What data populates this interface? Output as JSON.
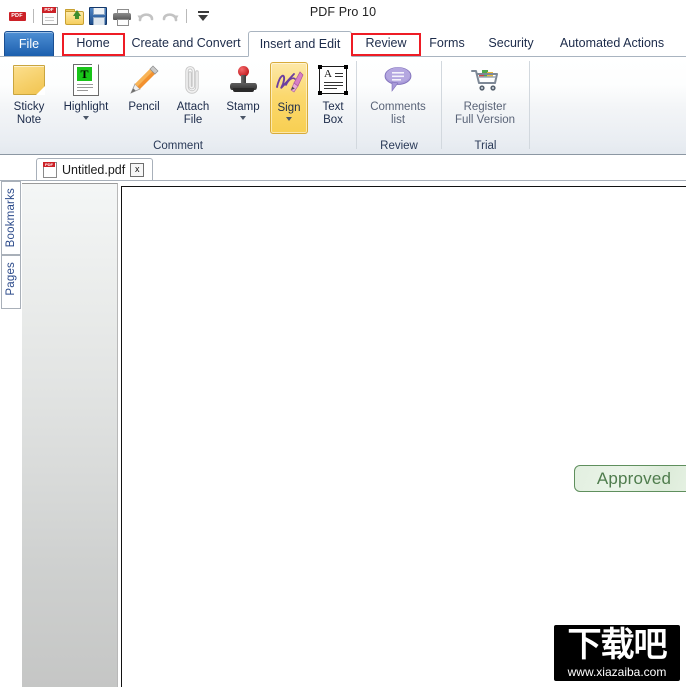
{
  "window": {
    "title": "PDF Pro 10"
  },
  "quick_access": {
    "items": [
      {
        "name": "app-pdf-icon",
        "label": "PDF"
      },
      {
        "name": "new-pdf-icon",
        "label": "PDF"
      },
      {
        "name": "open-file-icon",
        "label": ""
      },
      {
        "name": "save-icon",
        "label": ""
      },
      {
        "name": "print-icon",
        "label": ""
      },
      {
        "name": "undo-icon",
        "label": ""
      },
      {
        "name": "redo-icon",
        "label": ""
      },
      {
        "name": "customize-toolbar-icon",
        "label": ""
      }
    ]
  },
  "ribbon_tabs": {
    "file": "File",
    "items": [
      {
        "label": "Home",
        "highlighted": true,
        "active": false
      },
      {
        "label": "Create and Convert",
        "highlighted": false,
        "active": false
      },
      {
        "label": "Insert and Edit",
        "highlighted": false,
        "active": false
      },
      {
        "label": "Review",
        "highlighted": true,
        "active": true
      },
      {
        "label": "Forms",
        "highlighted": false,
        "active": false
      },
      {
        "label": "Security",
        "highlighted": false,
        "active": false
      },
      {
        "label": "Automated Actions",
        "highlighted": false,
        "active": false
      }
    ]
  },
  "ribbon": {
    "groups": [
      {
        "label": "Comment"
      },
      {
        "label": "Review"
      },
      {
        "label": "Trial"
      }
    ],
    "buttons": [
      {
        "line1": "Sticky",
        "line2": "Note",
        "icon": "sticky-note-icon",
        "dropdown": false,
        "selected": false
      },
      {
        "line1": "Highlight",
        "line2": "",
        "icon": "highlight-text-icon",
        "dropdown": true,
        "selected": false
      },
      {
        "line1": "Pencil",
        "line2": "",
        "icon": "pencil-icon",
        "dropdown": false,
        "selected": false
      },
      {
        "line1": "Attach",
        "line2": "File",
        "icon": "paperclip-icon",
        "dropdown": false,
        "selected": false
      },
      {
        "line1": "Stamp",
        "line2": "",
        "icon": "stamp-icon",
        "dropdown": true,
        "selected": false
      },
      {
        "line1": "Sign",
        "line2": "",
        "icon": "signature-icon",
        "dropdown": true,
        "selected": true
      },
      {
        "line1": "Text",
        "line2": "Box",
        "icon": "text-box-icon",
        "dropdown": false,
        "selected": false
      },
      {
        "line1": "Comments",
        "line2": "list",
        "icon": "comment-bubble-icon",
        "dropdown": false,
        "selected": false
      },
      {
        "line1": "Register",
        "line2": "Full Version",
        "icon": "shopping-cart-icon",
        "dropdown": false,
        "selected": false
      }
    ]
  },
  "document_tab": {
    "filename": "Untitled.pdf",
    "close_label": "x",
    "icon": "pdf-file-icon"
  },
  "side_tabs": [
    {
      "label": "Bookmarks"
    },
    {
      "label": "Pages"
    }
  ],
  "page_content": {
    "stamp": {
      "text": "Approved",
      "border_color": "#5f8f5d",
      "text_color": "#4f7c4d",
      "fill_color": "#e5f1e2"
    }
  },
  "watermark": {
    "brand": "下载吧",
    "url": "www.xiazaiba.com"
  },
  "colors": {
    "file_tab": "#1c5fae",
    "highlight_box": "#ee1c25",
    "selected_button": "#f8cf52",
    "ribbon_text": "#1c2b4a"
  }
}
